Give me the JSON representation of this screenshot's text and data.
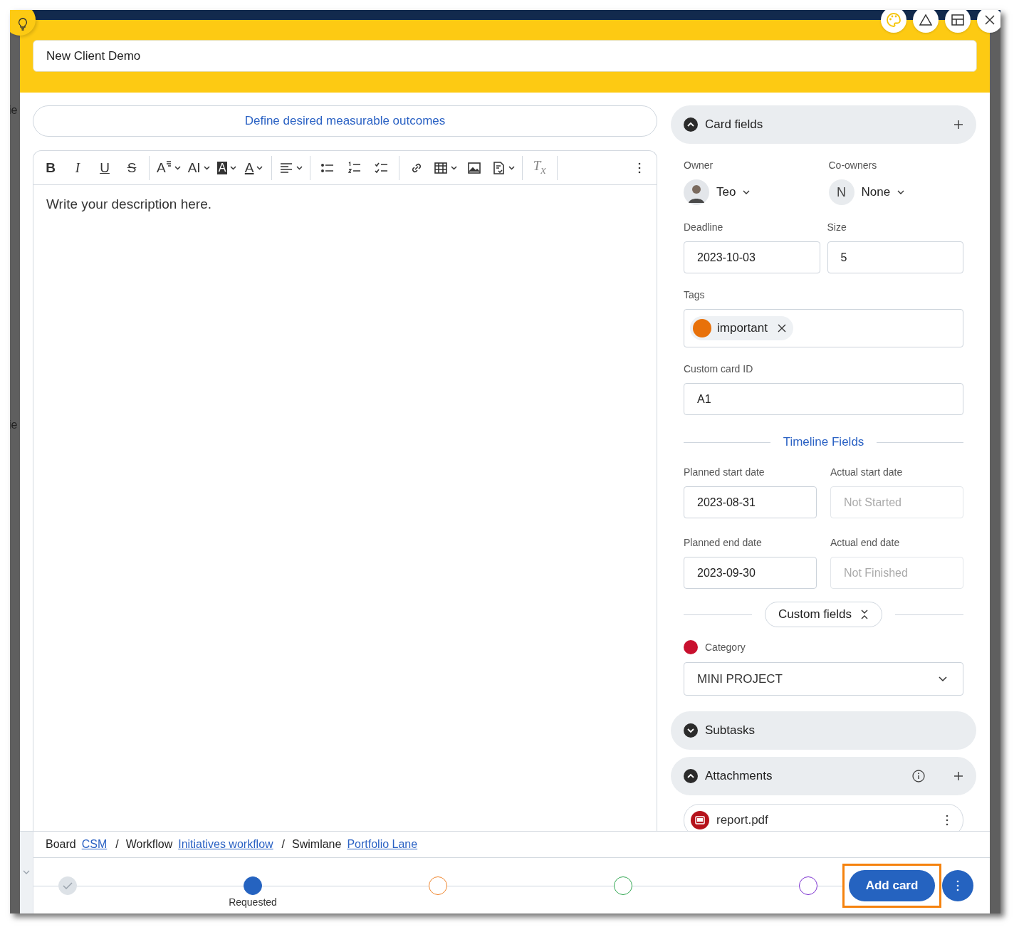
{
  "backdrop": {
    "labels": [
      "ie",
      "ie"
    ]
  },
  "window_controls": [
    {
      "kind": "palette"
    },
    {
      "kind": "warning"
    },
    {
      "kind": "layout"
    },
    {
      "kind": "close"
    }
  ],
  "title": {
    "value": "New Client Demo"
  },
  "outcomes_button": "Define desired measurable outcomes",
  "editor": {
    "toolbar": [
      {
        "kind": "bold",
        "glyph": "B"
      },
      {
        "kind": "italic",
        "glyph": "I"
      },
      {
        "kind": "underline",
        "glyph": "U"
      },
      {
        "kind": "strike",
        "glyph": "S"
      },
      {
        "kind": "sep"
      },
      {
        "kind": "font-size",
        "glyph": "A",
        "caret": true
      },
      {
        "kind": "text-case",
        "glyph": "AI",
        "caret": true
      },
      {
        "kind": "highlight",
        "glyph": "A",
        "caret": true
      },
      {
        "kind": "font-color",
        "glyph": "A",
        "caret": true
      },
      {
        "kind": "sep"
      },
      {
        "kind": "align",
        "caret": true
      },
      {
        "kind": "sep"
      },
      {
        "kind": "bullets"
      },
      {
        "kind": "numbered"
      },
      {
        "kind": "checklist"
      },
      {
        "kind": "sep"
      },
      {
        "kind": "link"
      },
      {
        "kind": "table",
        "caret": true
      },
      {
        "kind": "image"
      },
      {
        "kind": "template",
        "caret": true
      },
      {
        "kind": "sep"
      },
      {
        "kind": "clear-format",
        "glyph": "T$_{x}$"
      },
      {
        "kind": "sep"
      },
      {
        "kind": "more"
      }
    ],
    "placeholder": "Write your description here."
  },
  "card_fields": {
    "title": "Card fields",
    "expanded": true,
    "owner": {
      "label": "Owner",
      "name": "Teo"
    },
    "co_owners": {
      "label": "Co-owners",
      "initial": "N",
      "name": "None"
    },
    "deadline": {
      "label": "Deadline",
      "value": "2023-10-03"
    },
    "size": {
      "label": "Size",
      "value": "5"
    },
    "tags": {
      "label": "Tags",
      "items": [
        {
          "name": "important",
          "color": "#e8710a"
        }
      ]
    },
    "custom_card_id": {
      "label": "Custom card ID",
      "value": "A1"
    },
    "timeline_heading": "Timeline Fields",
    "timeline": [
      {
        "label": "Planned start date",
        "value": "2023-08-31"
      },
      {
        "label": "Actual start date",
        "placeholder": "Not Started"
      },
      {
        "label": "Planned end date",
        "value": "2023-09-30"
      },
      {
        "label": "Actual end date",
        "placeholder": "Not Finished"
      }
    ],
    "custom_fields": {
      "label": "Custom fields",
      "expanded": true
    },
    "category": {
      "label": "Category",
      "color": "#c8102e",
      "value": "MINI PROJECT"
    }
  },
  "subtasks": {
    "title": "Subtasks",
    "expanded": false
  },
  "attachments": {
    "title": "Attachments",
    "expanded": true,
    "files": [
      {
        "name": "report.pdf"
      }
    ]
  },
  "breadcrumb": {
    "separator": "/",
    "items": [
      {
        "label": "Board",
        "link": "CSM"
      },
      {
        "label": "Workflow",
        "link": "Initiatives workflow"
      },
      {
        "label": "Swimlane",
        "link": "Portfolio Lane"
      }
    ]
  },
  "stepper": [
    {
      "completed": true,
      "selected": false,
      "color": "#dde2e7"
    },
    {
      "completed": false,
      "selected": true,
      "color": "#2563c0",
      "label": "Requested"
    },
    {
      "completed": false,
      "selected": false,
      "color": "#f0862e"
    },
    {
      "completed": false,
      "selected": false,
      "color": "#33a853"
    },
    {
      "completed": false,
      "selected": false,
      "color": "#7b2fd0"
    }
  ],
  "actions": {
    "primary": "Add card",
    "highlighted": true
  }
}
